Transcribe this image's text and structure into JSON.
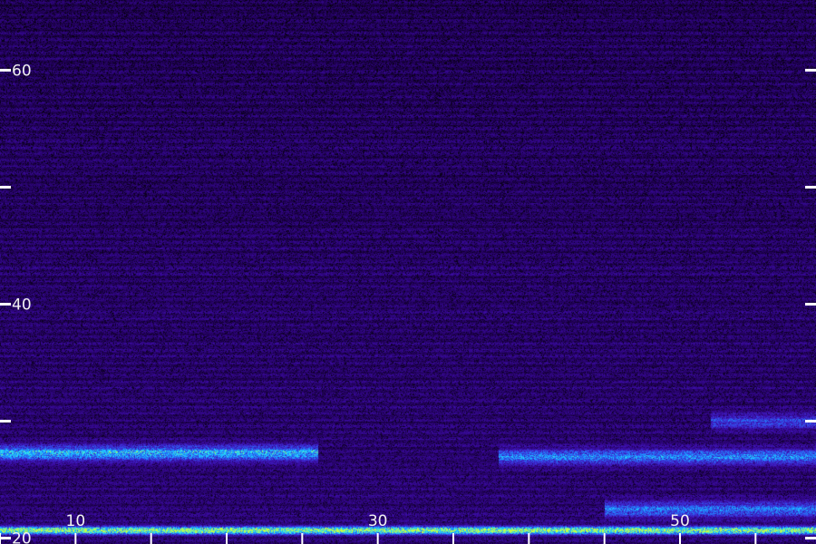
{
  "chart_data": {
    "type": "heatmap",
    "title": "",
    "xlabel": "",
    "ylabel": "",
    "xlim": [
      5,
      59
    ],
    "ylim": [
      19.5,
      66
    ],
    "x_ticks": [
      5,
      10,
      15,
      20,
      25,
      30,
      35,
      40,
      45,
      50,
      55,
      60
    ],
    "x_tick_labels": [
      {
        "value": 10,
        "text": "10"
      },
      {
        "value": 30,
        "text": "30"
      },
      {
        "value": 50,
        "text": "50"
      }
    ],
    "y_ticks": [
      20,
      30,
      40,
      50,
      60
    ],
    "y_tick_labels": [
      {
        "value": 60,
        "text": "60"
      },
      {
        "value": 40,
        "text": "40"
      },
      {
        "value": 20,
        "text": "20"
      }
    ],
    "background_color": "#1e0050",
    "colormap": [
      "#000000",
      "#1e0050",
      "#3a0aa0",
      "#3c30d8",
      "#1e88ff",
      "#20e0ff",
      "#c8ff40"
    ],
    "bands": [
      {
        "y": 20.7,
        "x_range": [
          5,
          59
        ],
        "intensity": 0.9
      },
      {
        "y": 27.3,
        "x_range": [
          5,
          26
        ],
        "intensity": 0.6
      },
      {
        "y": 27.0,
        "x_range": [
          38,
          59
        ],
        "intensity": 0.5
      },
      {
        "y": 22.5,
        "x_range": [
          45,
          59
        ],
        "intensity": 0.45
      },
      {
        "y": 30.0,
        "x_range": [
          52,
          59
        ],
        "intensity": 0.35
      }
    ]
  }
}
